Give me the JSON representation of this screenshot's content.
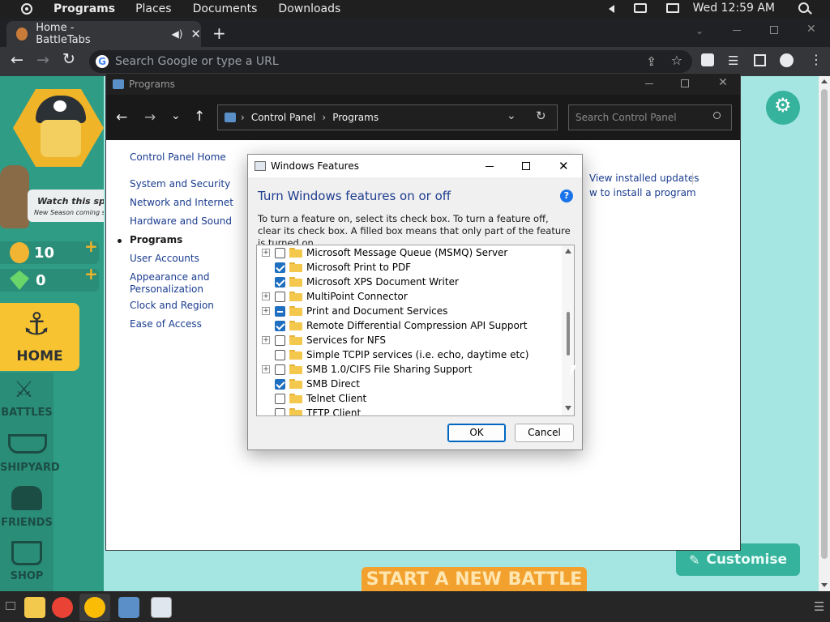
{
  "topbar": {
    "menus": [
      "Programs",
      "Places",
      "Documents",
      "Downloads"
    ],
    "clock": "Wed 12:59 AM"
  },
  "browser": {
    "tab_title": "Home - BattleTabs",
    "omnibox_placeholder": "Search Google or type a URL"
  },
  "game": {
    "banner_line1": "Watch this space",
    "banner_line2": "New Season coming soon",
    "coins": "10",
    "gems": "0",
    "nav": [
      "HOME",
      "BATTLES",
      "SHIPYARD",
      "FRIENDS",
      "SHOP"
    ],
    "customise_label": "Customise",
    "new_battle_label": "START A NEW BATTLE"
  },
  "control_panel": {
    "window_title": "Programs",
    "breadcrumb": [
      "Control Panel",
      "Programs"
    ],
    "search_placeholder": "Search Control Panel",
    "home_link": "Control Panel Home",
    "links": [
      "System and Security",
      "Network and Internet",
      "Hardware and Sound",
      "Programs",
      "User Accounts",
      "Appearance and Personalization",
      "Clock and Region",
      "Ease of Access"
    ],
    "active_link": "Programs",
    "right_links": [
      "View installed updates",
      "w to install a program"
    ]
  },
  "windows_features": {
    "title": "Windows Features",
    "heading": "Turn Windows features on or off",
    "description": "To turn a feature on, select its check box. To turn a feature off, clear its check box. A filled box means that only part of the feature is turned on.",
    "features": [
      {
        "name": "Microsoft Message Queue (MSMQ) Server",
        "expandable": true,
        "state": "unchecked"
      },
      {
        "name": "Microsoft Print to PDF",
        "expandable": false,
        "state": "checked"
      },
      {
        "name": "Microsoft XPS Document Writer",
        "expandable": false,
        "state": "checked"
      },
      {
        "name": "MultiPoint Connector",
        "expandable": true,
        "state": "unchecked"
      },
      {
        "name": "Print and Document Services",
        "expandable": true,
        "state": "partial"
      },
      {
        "name": "Remote Differential Compression API Support",
        "expandable": false,
        "state": "checked"
      },
      {
        "name": "Services for NFS",
        "expandable": true,
        "state": "unchecked"
      },
      {
        "name": "Simple TCPIP services (i.e. echo, daytime etc)",
        "expandable": false,
        "state": "unchecked"
      },
      {
        "name": "SMB 1.0/CIFS File Sharing Support",
        "expandable": true,
        "state": "unchecked"
      },
      {
        "name": "SMB Direct",
        "expandable": false,
        "state": "checked"
      },
      {
        "name": "Telnet Client",
        "expandable": false,
        "state": "unchecked"
      },
      {
        "name": "TFTP Client",
        "expandable": false,
        "state": "unchecked"
      }
    ],
    "ok_label": "OK",
    "cancel_label": "Cancel"
  }
}
